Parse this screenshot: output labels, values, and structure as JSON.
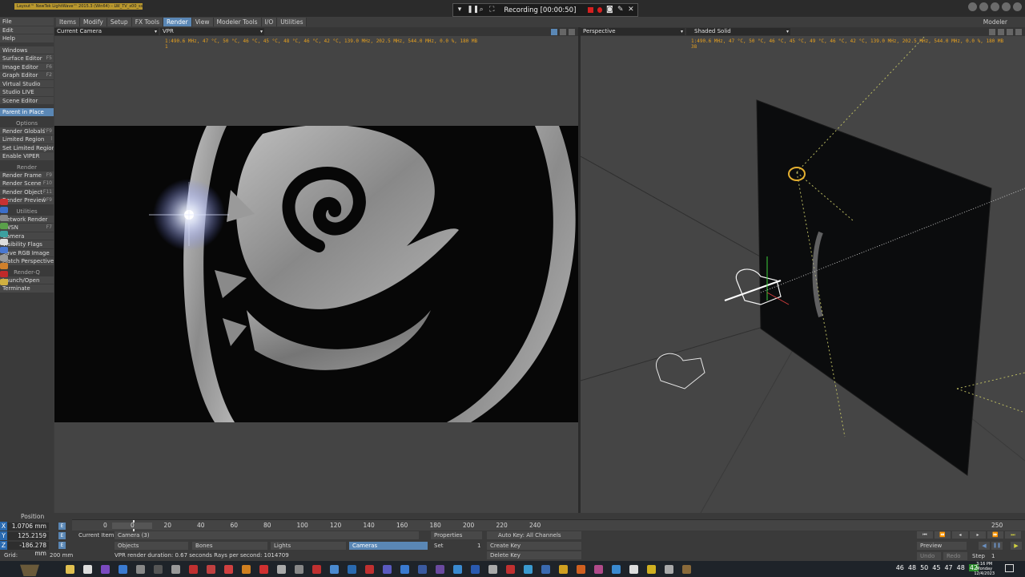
{
  "window": {
    "title_chip": "Layout™ NewTek LightWave™ 2015.3 (Win64) – LW_TV_x00_sss"
  },
  "recording": {
    "text": "Recording [00:00:50]"
  },
  "top_right": {
    "modeler_label": "Modeler"
  },
  "tabs": [
    {
      "label": "Items"
    },
    {
      "label": "Modify"
    },
    {
      "label": "Setup"
    },
    {
      "label": "FX Tools"
    },
    {
      "label": "Render",
      "active": true
    },
    {
      "label": "View"
    },
    {
      "label": "Modeler Tools"
    },
    {
      "label": "I/O"
    },
    {
      "label": "Utilities"
    }
  ],
  "left_panel": {
    "top_items": [
      {
        "label": "File"
      },
      {
        "label": "Edit"
      },
      {
        "label": "Help"
      }
    ],
    "window_items": [
      {
        "label": "Windows"
      },
      {
        "label": "Surface Editor",
        "key": "F5"
      },
      {
        "label": "Image Editor",
        "key": "F6"
      },
      {
        "label": "Graph Editor",
        "key": "F2"
      },
      {
        "label": "Virtual Studio"
      },
      {
        "label": "Studio LIVE"
      },
      {
        "label": "Scene Editor"
      }
    ],
    "parent_in_place": "Parent in Place",
    "options_head": "Options",
    "options_items": [
      {
        "label": "Render Globals",
        "key": "^F9"
      },
      {
        "label": "Limited Region",
        "key": "l"
      },
      {
        "label": "Set Limited Region"
      },
      {
        "label": "Enable VIPER"
      }
    ],
    "render_head": "Render",
    "render_items": [
      {
        "label": "Render Frame",
        "key": "F9"
      },
      {
        "label": "Render Scene",
        "key": "F10"
      },
      {
        "label": "Render Object",
        "key": "F11"
      },
      {
        "label": "Render Preview",
        "key": "^F9"
      }
    ],
    "utilities_head": "Utilities",
    "utilities_items": [
      {
        "label": "Network Render"
      },
      {
        "label": "LWSN",
        "key": "F7"
      },
      {
        "label": "Camera"
      },
      {
        "label": "Visibility Flags"
      },
      {
        "label": "Save RGB Image"
      },
      {
        "label": "Match Perspective"
      }
    ],
    "renderq_head": "Render-Q",
    "renderq_items": [
      {
        "label": "Launch/Open"
      },
      {
        "label": "Terminate"
      }
    ]
  },
  "left_viewport": {
    "camera_select": "Current Camera",
    "mode_select": "VPR",
    "stats": "1:490.6 MHz, 47 °C, 50 °C, 46 °C, 45 °C, 48 °C, 46 °C, 42 °C, 139.0 MHz, 202.5 MHz, 544.0 MHz, 0.0 %, 180 MB",
    "stats_line2": "1"
  },
  "right_viewport": {
    "view_select": "Perspective",
    "shading_select": "Shaded Solid",
    "stats": "1:490.6 MHz, 47 °C, 50 °C, 46 °C, 45 °C, 49 °C, 46 °C, 42 °C, 139.0 MHz, 202.5 MHz, 544.0 MHz, 0.0 %, 180 MB",
    "stats_line2": "38"
  },
  "bottom": {
    "position_label": "Position",
    "x_value": "1.0706 mm",
    "y_value": "125.2159 mm",
    "z_value": "-186.278 mm",
    "grid_label": "Grid:",
    "grid_value": "200 mm",
    "current_item_label": "Current Item",
    "current_item_value": "Camera (3)",
    "properties_label": "Properties",
    "auto_key_label": "Auto Key: All Channels",
    "objects_label": "Objects",
    "bones_label": "Bones",
    "lights_label": "Lights",
    "cameras_label": "Cameras",
    "set_label": "Set",
    "set_value": "1",
    "create_key_label": "Create Key",
    "delete_key_label": "Delete Key",
    "status": "VPR render duration: 0.67 seconds  Rays per second: 1014709",
    "preview_label": "Preview",
    "step_label": "Step",
    "step_value": "1",
    "undo_label": "Undo",
    "redo_label": "Redo",
    "timeline_start": "0",
    "timeline_ticks": [
      "0",
      "20",
      "40",
      "60",
      "80",
      "100",
      "120",
      "140",
      "160",
      "180",
      "200",
      "220",
      "240",
      "250"
    ]
  },
  "taskbar": {
    "tray_numbers": [
      "46",
      "48",
      "50",
      "45",
      "47",
      "48",
      "42"
    ],
    "clock_time": "3:16 PM",
    "clock_day": "Monday",
    "clock_date": "12/4/2023"
  },
  "colors": {
    "accent": "#5a87b5",
    "stats": "#e5a020",
    "record": "#d62020"
  }
}
